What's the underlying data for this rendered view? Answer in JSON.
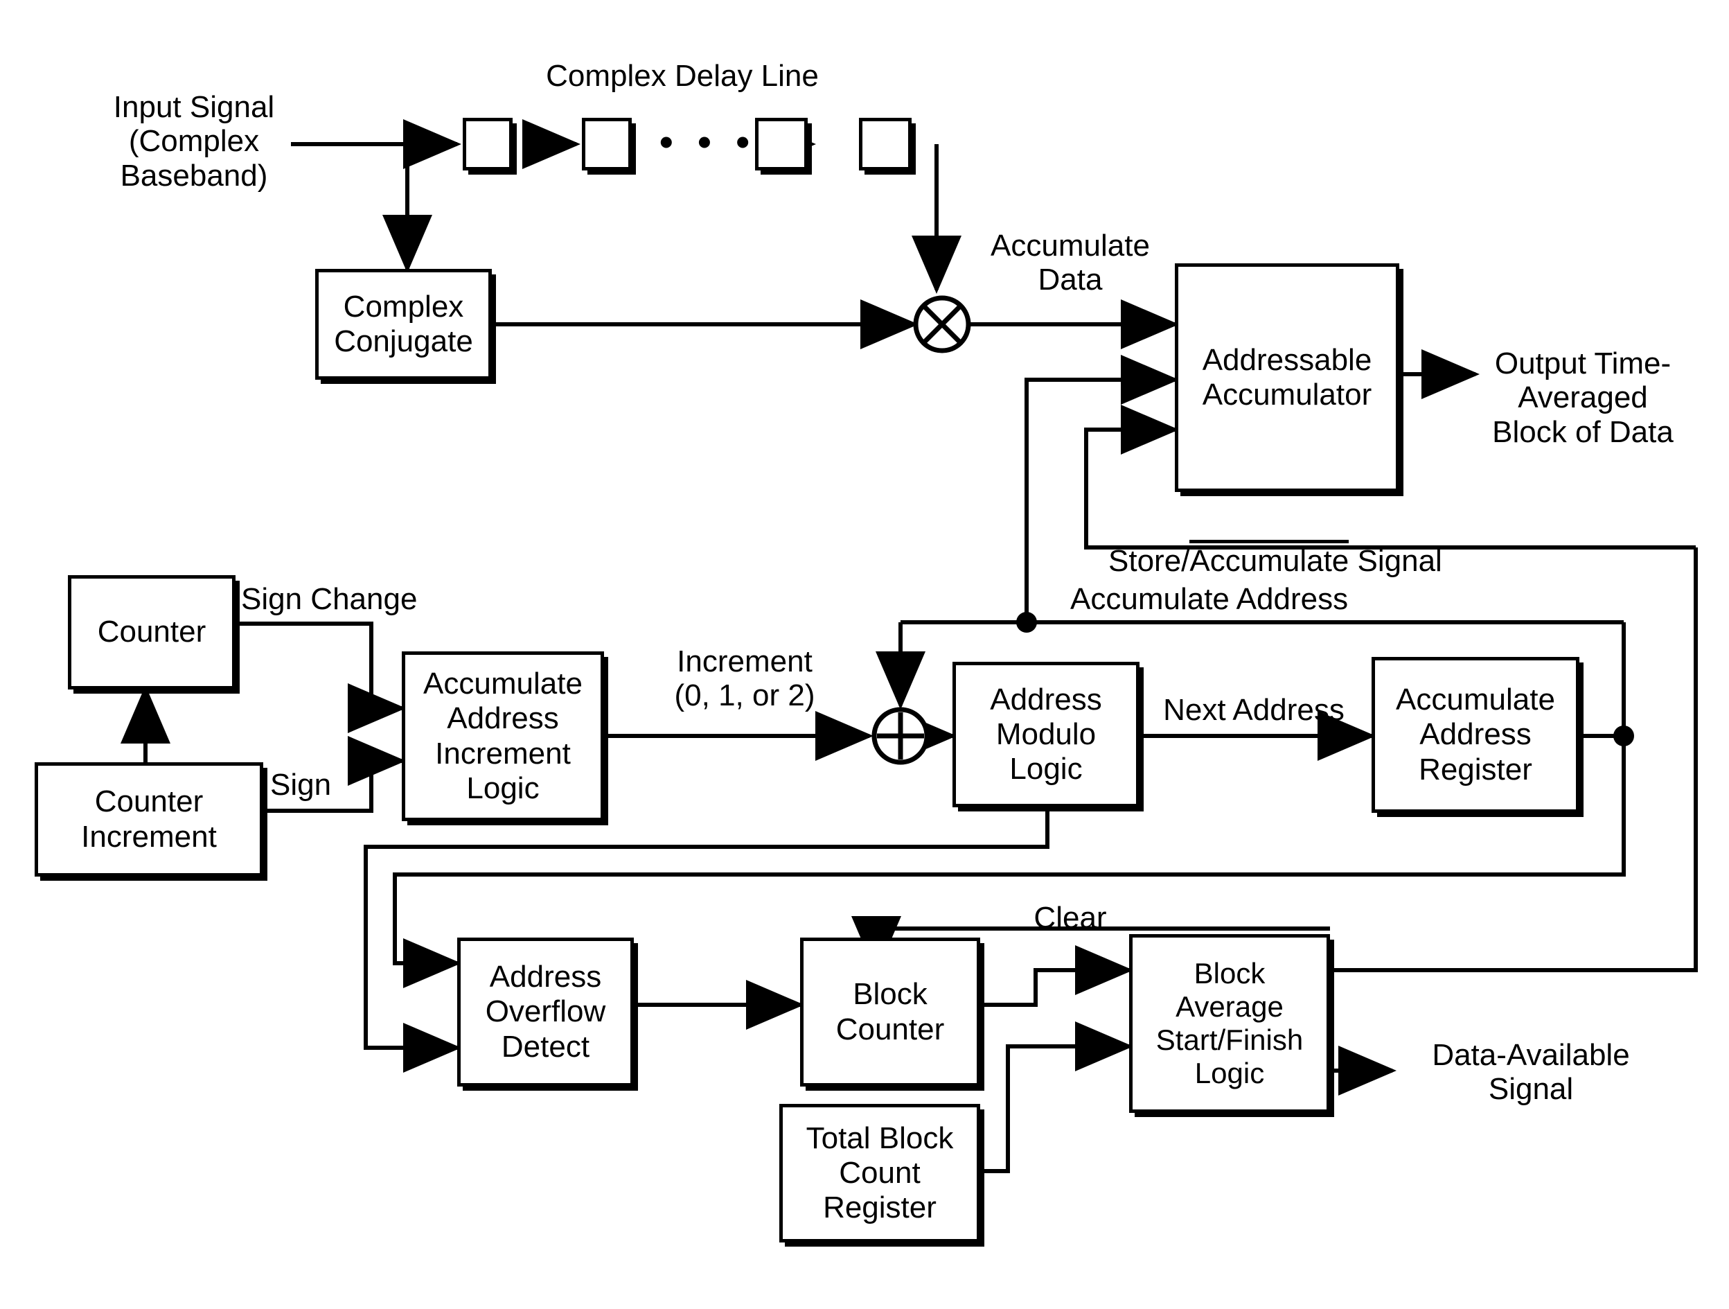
{
  "diagram": {
    "title": "Addressable Accumulator Time-Averaging Block Diagram",
    "labels": {
      "input_signal": "Input Signal\n(Complex\nBaseband)",
      "complex_delay_line": "Complex Delay Line",
      "delay_dots": "• • •",
      "accumulate_data": "Accumulate\nData",
      "output_block": "Output Time-\nAveraged\nBlock of Data",
      "store_accumulate_prefix": "Store/",
      "store_accumulate_overline": "Accumulate",
      "store_accumulate_suffix": " Signal",
      "accumulate_address": "Accumulate Address",
      "sign_change": "Sign Change",
      "sign": "Sign",
      "increment": "Increment\n(0, 1, or 2)",
      "next_address": "Next Address",
      "clear": "Clear",
      "data_available": "Data-Available\nSignal"
    },
    "blocks": [
      {
        "id": "delay1",
        "label": ""
      },
      {
        "id": "delay2",
        "label": ""
      },
      {
        "id": "delay3",
        "label": ""
      },
      {
        "id": "delay4",
        "label": ""
      },
      {
        "id": "complex_conjugate",
        "label": "Complex\nConjugate"
      },
      {
        "id": "addressable_accumulator",
        "label": "Addressable\nAccumulator"
      },
      {
        "id": "counter",
        "label": "Counter"
      },
      {
        "id": "counter_increment",
        "label": "Counter\nIncrement"
      },
      {
        "id": "accumulate_address_increment_logic",
        "label": "Accumulate\nAddress\nIncrement\nLogic"
      },
      {
        "id": "address_modulo_logic",
        "label": "Address\nModulo\nLogic"
      },
      {
        "id": "accumulate_address_register",
        "label": "Accumulate\nAddress\nRegister"
      },
      {
        "id": "address_overflow_detect",
        "label": "Address\nOverflow\nDetect"
      },
      {
        "id": "block_counter",
        "label": "Block\nCounter"
      },
      {
        "id": "block_average_start_finish_logic",
        "label": "Block\nAverage\nStart/Finish\nLogic"
      },
      {
        "id": "total_block_count_register",
        "label": "Total Block\nCount\nRegister"
      }
    ],
    "operators": [
      {
        "id": "multiplier",
        "symbol": "X"
      },
      {
        "id": "adder",
        "symbol": "+"
      }
    ],
    "colors": {
      "line": "#000000",
      "background": "#ffffff",
      "text": "#000000"
    }
  }
}
